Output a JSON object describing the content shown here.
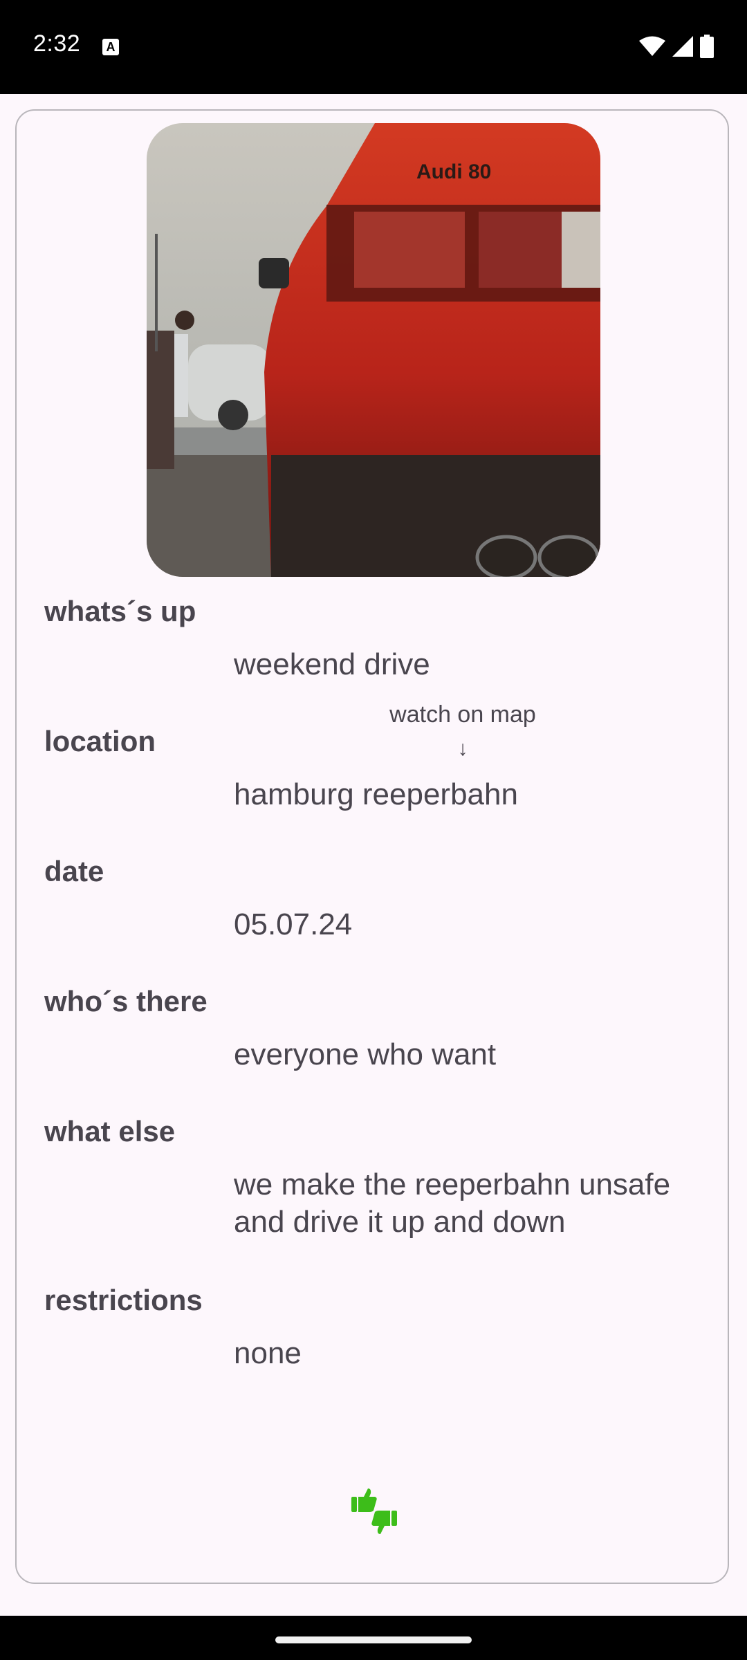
{
  "status_bar": {
    "time": "2:32",
    "icons": [
      "text-a-notification-icon",
      "wifi-icon",
      "signal-icon",
      "battery-icon"
    ]
  },
  "event": {
    "photo_alt": "red car rear",
    "fields": [
      {
        "label": "whats´s up",
        "value": "weekend drive"
      },
      {
        "label": "location",
        "value": "hamburg reeperbahn"
      },
      {
        "label": "date",
        "value": "05.07.24"
      },
      {
        "label": "who´s there",
        "value": "everyone who want"
      },
      {
        "label": "what else",
        "value": "we make the reeperbahn unsafe and drive it up and down"
      },
      {
        "label": "restrictions",
        "value": "none"
      }
    ],
    "map_link": "watch on map",
    "map_arrow": "↓"
  },
  "actions": {
    "vote_icon": "thumbs-up-down-icon",
    "accent_color": "#3dbd1a"
  },
  "colors": {
    "background": "#fdf7fc",
    "text": "#49454e",
    "border": "#b9b6bb"
  }
}
